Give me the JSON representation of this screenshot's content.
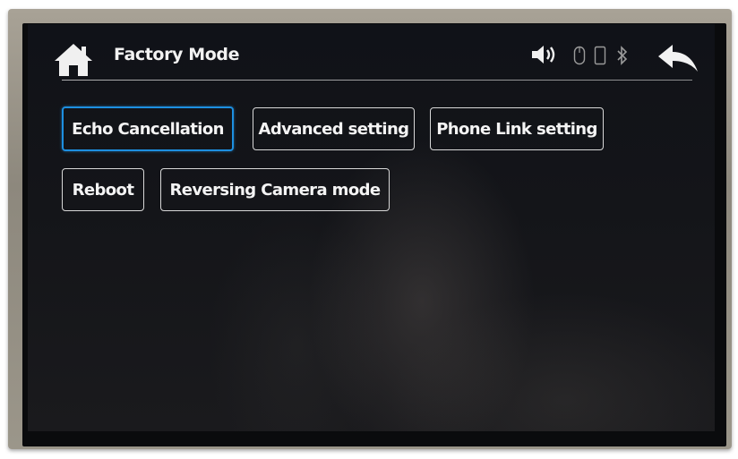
{
  "header": {
    "title": "Factory Mode",
    "home_icon": "home-icon",
    "back_icon": "back-arrow-icon",
    "status_icons": [
      "volume-icon",
      "mouse-icon",
      "phone-icon",
      "bluetooth-icon"
    ]
  },
  "menu": {
    "buttons": [
      {
        "label": "Echo Cancellation",
        "selected": true
      },
      {
        "label": "Advanced setting",
        "selected": false
      },
      {
        "label": "Phone Link setting",
        "selected": false
      },
      {
        "label": "Reboot",
        "selected": false
      },
      {
        "label": "Reversing Camera mode",
        "selected": false
      }
    ]
  },
  "colors": {
    "selection_border": "#1d8fe0",
    "text": "#f4f4f4",
    "screen_background": "#121318"
  }
}
